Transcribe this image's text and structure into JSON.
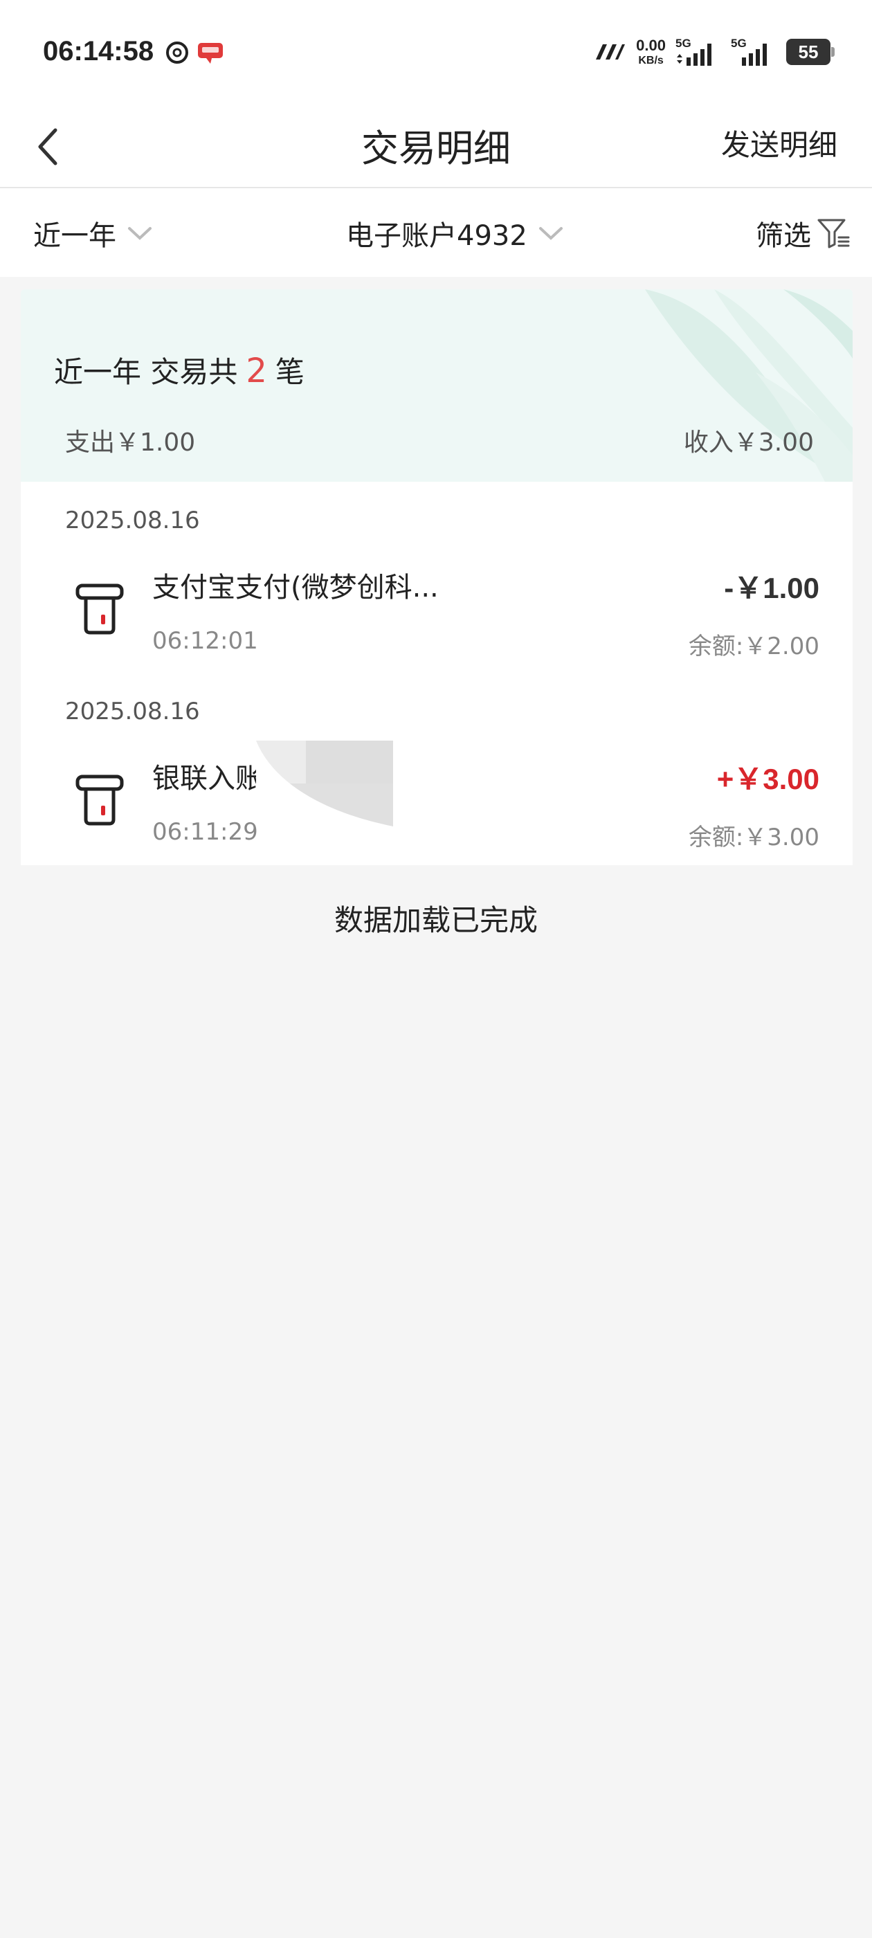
{
  "status_bar": {
    "time": "06:14:58",
    "net_speed_value": "0.00",
    "net_speed_unit": "KB/s",
    "sim1_label": "5G",
    "sim2_label": "5G",
    "battery": "55"
  },
  "nav": {
    "title": "交易明细",
    "action": "发送明细"
  },
  "filters": {
    "period": "近一年",
    "account": "电子账户4932",
    "screen": "筛选"
  },
  "summary": {
    "prefix": "近一年 交易共",
    "count": "2",
    "suffix": "笔",
    "expense": "支出￥1.00",
    "income": "收入￥3.00"
  },
  "transactions": [
    {
      "date": "2025.08.16",
      "name": "支付宝支付(微梦创科...",
      "time": "06:12:01",
      "amount": "-￥1.00",
      "balance": "余额:￥2.00"
    },
    {
      "date": "2025.08.16",
      "name": "银联入账(",
      "time": "06:11:29",
      "amount": "+￥3.00",
      "balance": "余额:￥3.00"
    }
  ],
  "footer": "数据加载已完成",
  "colors": {
    "accent_red": "#d9262c",
    "count_red": "#e24b4b",
    "summary_bg": "#eef8f6",
    "page_bg": "#f5f5f5"
  }
}
